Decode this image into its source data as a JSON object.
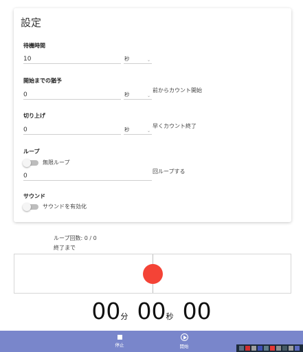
{
  "settings": {
    "title": "設定",
    "wait_time": {
      "label": "待機時間",
      "value": "10",
      "unit": "秒"
    },
    "grace_period": {
      "label": "開始までの猶予",
      "value": "0",
      "unit": "秒",
      "suffix": "前からカウント開始"
    },
    "round_up": {
      "label": "切り上げ",
      "value": "0",
      "unit": "秒",
      "suffix": "早くカウント終了"
    },
    "loop": {
      "label": "ループ",
      "toggle_label": "無限ループ",
      "toggle_on": false,
      "value": "0",
      "suffix": "回ループする"
    },
    "sound": {
      "label": "サウンド",
      "toggle_label": "サウンドを有効化",
      "toggle_on": false
    }
  },
  "status": {
    "loop_count": "ループ回数: 0 / 0",
    "until_end": "終了まで"
  },
  "progress": {
    "fraction": 0.5,
    "color": "#f44336"
  },
  "timer": {
    "minutes": "00",
    "minutes_unit": "分",
    "seconds": "00",
    "seconds_unit": "秒",
    "centis": "00"
  },
  "controls": {
    "stop_label": "停止",
    "start_label": "開始"
  },
  "colors": {
    "bottom_bar": "#7986cb",
    "accent_red": "#f44336"
  },
  "icons": {
    "stop": "stop-icon",
    "play": "play-circle-icon"
  }
}
